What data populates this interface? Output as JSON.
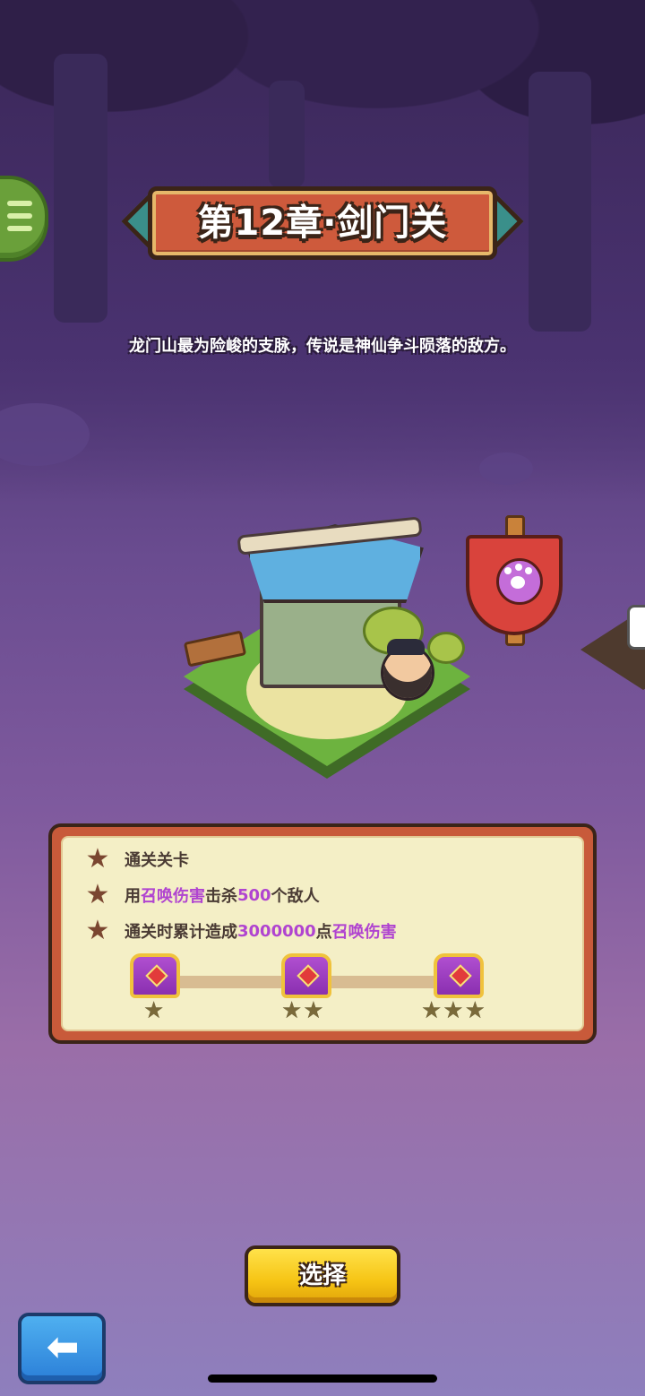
{
  "chapter": {
    "title": "第12章·剑门关",
    "description": "龙门山最为险峻的支脉，传说是神仙争斗陨落的敌方。"
  },
  "goals": [
    {
      "text_before": "通关关卡",
      "highlight1": "",
      "text_mid": "",
      "highlight2": "",
      "text_after": ""
    },
    {
      "text_before": "用",
      "highlight1": "召唤伤害",
      "text_mid": "击杀",
      "highlight2": "500",
      "text_after": "个敌人"
    },
    {
      "text_before": "通关时累计造成",
      "highlight1": "3000000",
      "text_mid": "点",
      "highlight2": "召唤伤害",
      "text_after": ""
    }
  ],
  "rewards": [
    {
      "stars": "★"
    },
    {
      "stars": "★★"
    },
    {
      "stars": "★★★"
    }
  ],
  "buttons": {
    "select_label": "选择",
    "back_icon": "back-arrow-icon",
    "menu_icon": "menu-icon"
  },
  "map": {
    "next_stage_icon": "lock-icon",
    "flag_icon": "paw-icon"
  },
  "colors": {
    "highlight": "#b044d0",
    "select_button": "#f6c414",
    "back_button": "#2b7fd8",
    "panel_border": "#c85a3a"
  }
}
